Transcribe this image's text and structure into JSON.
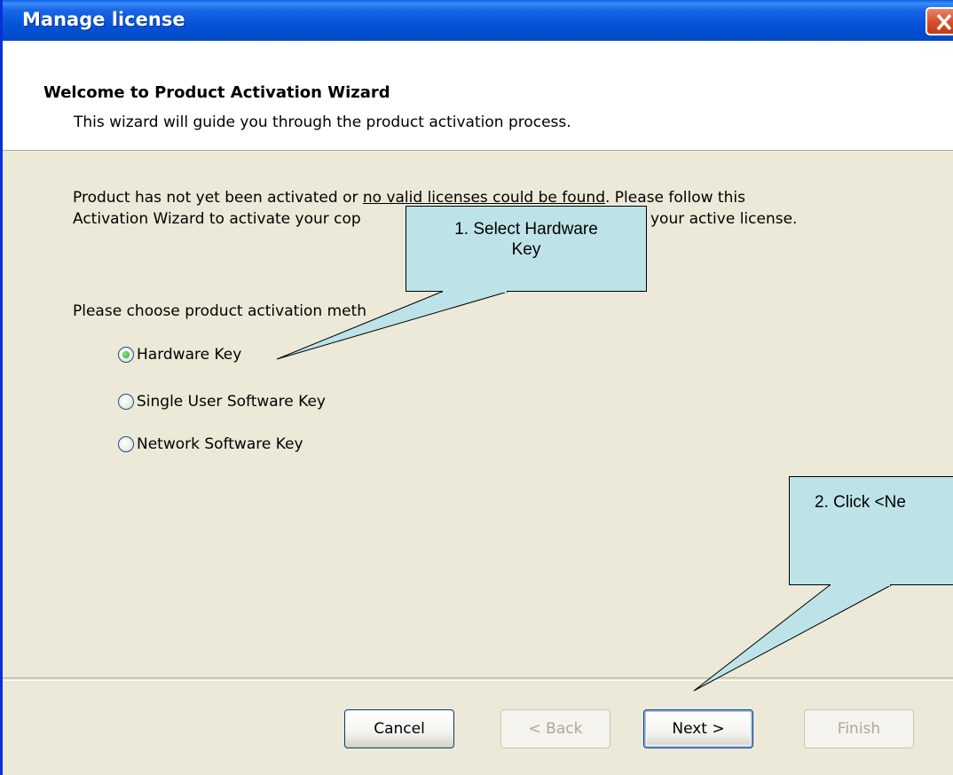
{
  "window": {
    "title": "Manage license"
  },
  "header": {
    "title": "Welcome to Product Activation Wizard",
    "subtitle": "This wizard will guide you through the product activation process."
  },
  "body": {
    "line1_before": "Product has not yet been activated or ",
    "line1_underlined": "no valid licenses could be found",
    "line1_after": ". Please follow this",
    "line2_start": "Activation Wizard to activate your cop",
    "line2_end": "your active license.",
    "choose_label": "Please choose product activation meth"
  },
  "activation_methods": [
    {
      "label": "Hardware Key",
      "selected": true
    },
    {
      "label": "Single User Software Key",
      "selected": false
    },
    {
      "label": "Network Software Key",
      "selected": false
    }
  ],
  "buttons": {
    "cancel": "Cancel",
    "back": "< Back",
    "next": "Next >",
    "finish": "Finish"
  },
  "callouts": {
    "step1": "1. Select Hardware Key",
    "step2": "2. Click <Ne"
  },
  "colors": {
    "titlebar": "#0553d9",
    "dialog_bg": "#ece9d8",
    "callout_fill": "#bde3e8",
    "radio_checked": "#21a121"
  }
}
